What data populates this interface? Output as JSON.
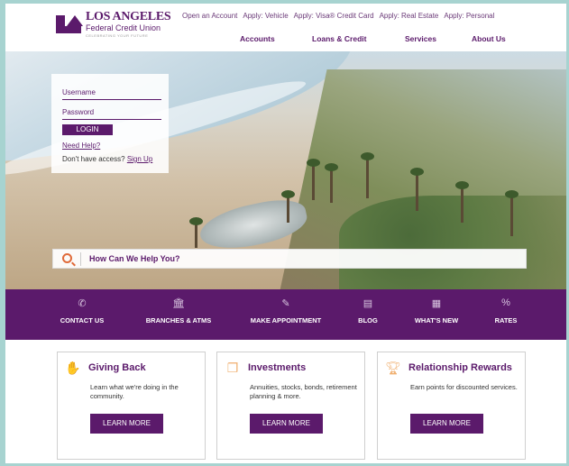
{
  "brand": {
    "name_line1": "LOS ANGELES",
    "name_line2": "Federal Credit Union",
    "tagline": "CELEBRATING YOUR FUTURE",
    "color": "#5b1a6b"
  },
  "top_links": [
    "Open an Account",
    "Apply: Vehicle",
    "Apply: Visa® Credit Card",
    "Apply: Real Estate",
    "Apply: Personal"
  ],
  "main_nav": [
    "Accounts",
    "Loans & Credit",
    "Services",
    "About Us"
  ],
  "login": {
    "username_placeholder": "Username",
    "password_placeholder": "Password",
    "login_button": "LOGIN",
    "need_help": "Need Help?",
    "no_access_text": "Don't have access?",
    "sign_up": "Sign Up"
  },
  "search": {
    "placeholder": "How Can We Help You?"
  },
  "quick_links": [
    {
      "label": "CONTACT US",
      "icon": "phone-icon"
    },
    {
      "label": "BRANCHES & ATMS",
      "icon": "bank-icon"
    },
    {
      "label": "MAKE APPOINTMENT",
      "icon": "edit-icon"
    },
    {
      "label": "BLOG",
      "icon": "newspaper-icon"
    },
    {
      "label": "WHAT'S NEW",
      "icon": "news-icon"
    },
    {
      "label": "RATES",
      "icon": "percent-icon"
    }
  ],
  "cards": [
    {
      "title": "Giving Back",
      "icon": "handshake-icon",
      "description": "Learn what we're doing in the community.",
      "button": "LEARN MORE"
    },
    {
      "title": "Investments",
      "icon": "piggy-bank-icon",
      "description": "Annuities, stocks, bonds, retirement planning & more.",
      "button": "LEARN MORE"
    },
    {
      "title": "Relationship Rewards",
      "icon": "trophy-icon",
      "description": "Earn points for discounted services.",
      "button": "LEARN MORE"
    }
  ]
}
